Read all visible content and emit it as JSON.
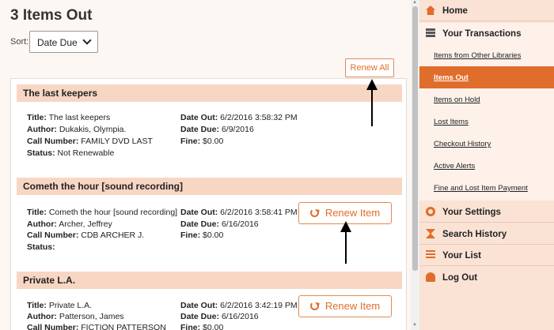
{
  "page": {
    "title": "3 Items Out"
  },
  "sort": {
    "label": "Sort:",
    "selected": "Date Due"
  },
  "renew_all": {
    "label": "Renew All"
  },
  "renew_button_label": "Renew Item",
  "items": [
    {
      "header": "The last keepers",
      "title_label": "Title:",
      "title": "The last keepers",
      "author_label": "Author:",
      "author": "Dukakis, Olympia.",
      "call_label": "Call Number:",
      "call": "FAMILY DVD LAST",
      "status_label": "Status:",
      "status": "Not Renewable",
      "date_out_label": "Date Out:",
      "date_out": "6/2/2016 3:58:32 PM",
      "date_due_label": "Date Due:",
      "date_due": "6/9/2016",
      "fine_label": "Fine:",
      "fine": "$0.00"
    },
    {
      "header": "Cometh the hour [sound recording]",
      "title_label": "Title:",
      "title": "Cometh the hour [sound recording]",
      "author_label": "Author:",
      "author": "Archer, Jeffrey",
      "call_label": "Call Number:",
      "call": "CDB ARCHER J.",
      "status_label": "Status:",
      "status": "",
      "date_out_label": "Date Out:",
      "date_out": "6/2/2016 3:58:41 PM",
      "date_due_label": "Date Due:",
      "date_due": "6/16/2016",
      "fine_label": "Fine:",
      "fine": "$0.00"
    },
    {
      "header": "Private L.A.",
      "title_label": "Title:",
      "title": "Private L.A.",
      "author_label": "Author:",
      "author": "Patterson, James",
      "call_label": "Call Number:",
      "call": "FICTION PATTERSON",
      "date_out_label": "Date Out:",
      "date_out": "6/2/2016 3:42:19 PM",
      "date_due_label": "Date Due:",
      "date_due": "6/16/2016",
      "fine_label": "Fine:",
      "fine": "$0.00"
    }
  ],
  "sidebar": {
    "home": "Home",
    "your_transactions": "Your Transactions",
    "sub": [
      "Items from Other Libraries",
      "Items Out",
      "Items on Hold",
      "Lost Items",
      "Checkout History",
      "Active Alerts",
      "Fine and Lost Item Payment"
    ],
    "your_settings": "Your Settings",
    "search_history": "Search History",
    "your_list": "Your List",
    "log_out": "Log Out"
  },
  "colors": {
    "accent": "#e06d2c",
    "header_band": "#f8d6c4",
    "sidebar_bg": "#fae3d5"
  }
}
